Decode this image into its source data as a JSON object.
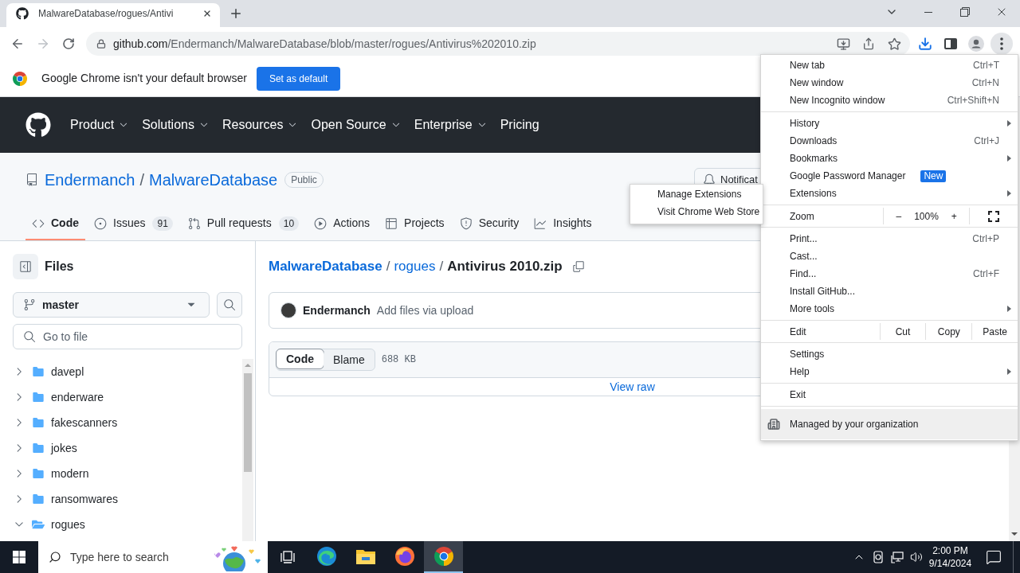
{
  "browser": {
    "tabs": [
      {
        "title": "MalwareDatabase/rogues/Antivi",
        "selected": true
      }
    ],
    "address": {
      "host": "github.com",
      "path": "/Endermanch/MalwareDatabase/blob/master/rogues/Antivirus%202010.zip"
    },
    "infobar": {
      "message": "Google Chrome isn't your default browser",
      "button": "Set as default"
    }
  },
  "site_nav": [
    {
      "label": "Product",
      "dropdown": true
    },
    {
      "label": "Solutions",
      "dropdown": true
    },
    {
      "label": "Resources",
      "dropdown": true
    },
    {
      "label": "Open Source",
      "dropdown": true
    },
    {
      "label": "Enterprise",
      "dropdown": true
    },
    {
      "label": "Pricing",
      "dropdown": false
    }
  ],
  "repo": {
    "owner": "Endermanch",
    "separator": "/",
    "name": "MalwareDatabase",
    "visibility": "Public",
    "notifications_button": "Notificat",
    "tabs": [
      {
        "label": "Code",
        "selected": true
      },
      {
        "label": "Issues",
        "counter": "91",
        "selected": false
      },
      {
        "label": "Pull requests",
        "counter": "10",
        "selected": false
      },
      {
        "label": "Actions",
        "selected": false
      },
      {
        "label": "Projects",
        "selected": false
      },
      {
        "label": "Security",
        "selected": false
      },
      {
        "label": "Insights",
        "selected": false
      }
    ]
  },
  "sidebar": {
    "title": "Files",
    "branch": "master",
    "search": {
      "placeholder": "Go to file"
    },
    "tree": [
      {
        "name": "davepl",
        "expanded": false
      },
      {
        "name": "enderware",
        "expanded": false
      },
      {
        "name": "fakescanners",
        "expanded": false
      },
      {
        "name": "jokes",
        "expanded": false
      },
      {
        "name": "modern",
        "expanded": false
      },
      {
        "name": "ransomwares",
        "expanded": false
      },
      {
        "name": "rogues",
        "expanded": true
      }
    ]
  },
  "breadcrumb": {
    "items": [
      {
        "label": "MalwareDatabase",
        "kind": "repo"
      },
      {
        "label": "rogues",
        "kind": "folder"
      },
      {
        "label": "Antivirus 2010.zip",
        "kind": "file"
      }
    ],
    "separators": [
      "/",
      "/"
    ]
  },
  "commit": {
    "author": "Endermanch",
    "message": "Add files via upload"
  },
  "file": {
    "views": [
      {
        "label": "Code",
        "selected": true
      },
      {
        "label": "Blame",
        "selected": false
      }
    ],
    "size": "688 KB",
    "raw_link": "View raw"
  },
  "menu": {
    "groups": [
      [
        {
          "kind": "item",
          "label": "New tab",
          "shortcut": "Ctrl+T",
          "submenu": false
        },
        {
          "kind": "item",
          "label": "New window",
          "shortcut": "Ctrl+N",
          "submenu": false
        },
        {
          "kind": "item",
          "label": "New Incognito window",
          "shortcut": "Ctrl+Shift+N",
          "submenu": false
        }
      ],
      [
        {
          "kind": "item",
          "label": "History",
          "submenu": true
        },
        {
          "kind": "item",
          "label": "Downloads",
          "shortcut": "Ctrl+J",
          "submenu": false
        },
        {
          "kind": "item",
          "label": "Bookmarks",
          "submenu": true
        },
        {
          "kind": "item",
          "label": "Google Password Manager",
          "badge": "New",
          "submenu": false
        },
        {
          "kind": "item",
          "label": "Extensions",
          "submenu": true
        }
      ],
      [
        {
          "kind": "zoom",
          "label": "Zoom",
          "minus": "–",
          "value": "100%",
          "plus": "+"
        }
      ],
      [
        {
          "kind": "item",
          "label": "Print...",
          "shortcut": "Ctrl+P",
          "submenu": false
        },
        {
          "kind": "item",
          "label": "Cast...",
          "submenu": false
        },
        {
          "kind": "item",
          "label": "Find...",
          "shortcut": "Ctrl+F",
          "submenu": false
        },
        {
          "kind": "item",
          "label": "Install GitHub...",
          "submenu": false
        },
        {
          "kind": "item",
          "label": "More tools",
          "submenu": true
        }
      ],
      [
        {
          "kind": "edit",
          "label": "Edit",
          "actions": [
            "Cut",
            "Copy",
            "Paste"
          ]
        }
      ],
      [
        {
          "kind": "item",
          "label": "Settings",
          "submenu": false
        },
        {
          "kind": "item",
          "label": "Help",
          "submenu": true
        }
      ],
      [
        {
          "kind": "item",
          "label": "Exit",
          "submenu": false
        }
      ],
      [
        {
          "kind": "managed",
          "label": "Managed by your organization"
        }
      ]
    ]
  },
  "extensions_submenu": {
    "items": [
      {
        "label": "Manage Extensions"
      },
      {
        "label": "Visit Chrome Web Store"
      }
    ]
  },
  "taskbar": {
    "search": {
      "placeholder": "Type here to search"
    },
    "apps": [
      {
        "selected": false
      },
      {
        "selected": false
      },
      {
        "selected": false
      },
      {
        "selected": true
      }
    ],
    "time": "2:00 PM",
    "date": "9/14/2024"
  }
}
